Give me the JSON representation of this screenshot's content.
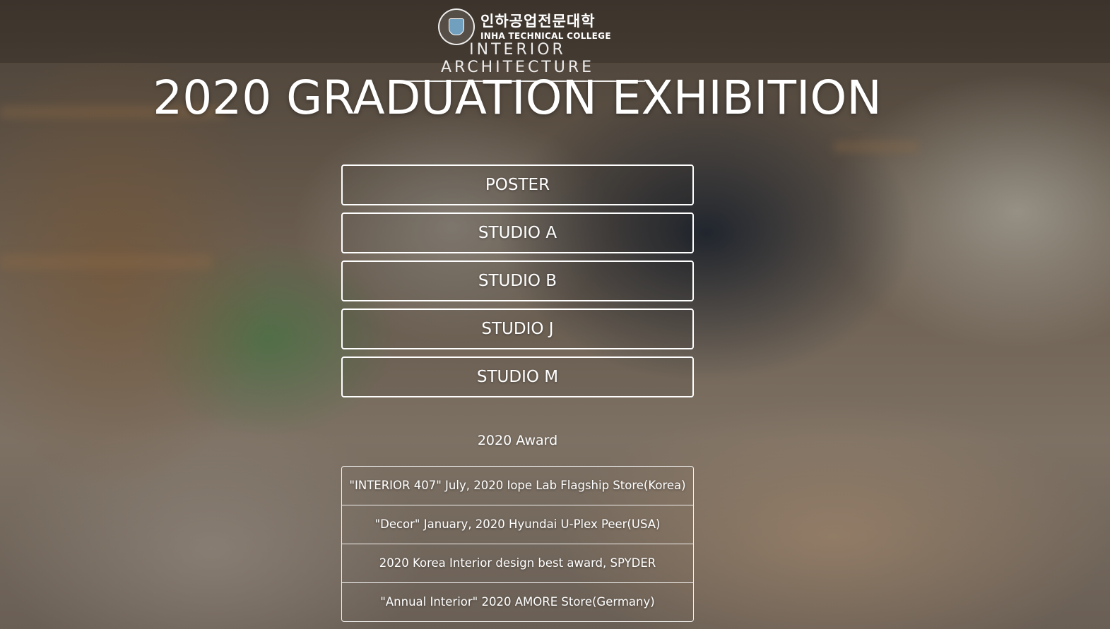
{
  "header": {
    "logo_korean": "인하공업전문대학",
    "logo_english": "INHA TECHNICAL COLLEGE",
    "department": "INTERIOR ARCHITECTURE"
  },
  "hero": {
    "title": "2020 GRADUATION EXHIBITION"
  },
  "menu": {
    "items": [
      {
        "label": "POSTER"
      },
      {
        "label": "STUDIO A"
      },
      {
        "label": "STUDIO B"
      },
      {
        "label": "STUDIO J"
      },
      {
        "label": "STUDIO M"
      }
    ]
  },
  "awards": {
    "heading": "2020 Award",
    "items": [
      {
        "text": "\"INTERIOR 407\" July, 2020 Iope Lab Flagship Store(Korea)"
      },
      {
        "text": "\"Decor\" January, 2020 Hyundai U-Plex Peer(USA)"
      },
      {
        "text": "2020 Korea Interior design best award, SPYDER"
      },
      {
        "text": "\"Annual Interior\" 2020 AMORE Store(Germany)"
      }
    ]
  }
}
